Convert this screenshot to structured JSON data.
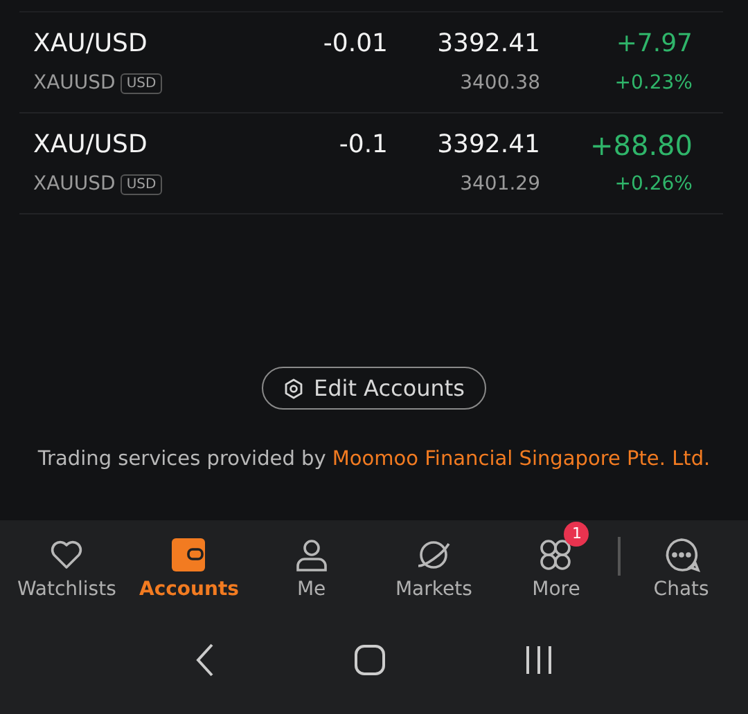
{
  "positions": [
    {
      "symbol": "XAU/USD",
      "code": "XAUUSD",
      "currency": "USD",
      "quantity": "-0.01",
      "price": "3392.41",
      "cost": "3400.38",
      "pl": "+7.97",
      "pl_ratio": "+0.23%",
      "large": false
    },
    {
      "symbol": "XAU/USD",
      "code": "XAUUSD",
      "currency": "USD",
      "quantity": "-0.1",
      "price": "3392.41",
      "cost": "3401.29",
      "pl": "+88.80",
      "pl_ratio": "+0.26%",
      "large": true
    }
  ],
  "edit_button": {
    "label": "Edit Accounts"
  },
  "footer": {
    "text": "Trading services provided by ",
    "link": "Moomoo Financial Singapore Pte. Ltd."
  },
  "tabs": [
    {
      "kind": "heart",
      "label": "Watchlists",
      "selected": false
    },
    {
      "kind": "wallet",
      "label": "Accounts",
      "selected": true
    },
    {
      "kind": "person",
      "label": "Me",
      "selected": false
    },
    {
      "kind": "planet",
      "label": "Markets",
      "selected": false
    },
    {
      "kind": "grid",
      "label": "More",
      "selected": false,
      "badge": "1"
    },
    {
      "kind": "chat",
      "label": "Chats",
      "selected": false
    }
  ]
}
